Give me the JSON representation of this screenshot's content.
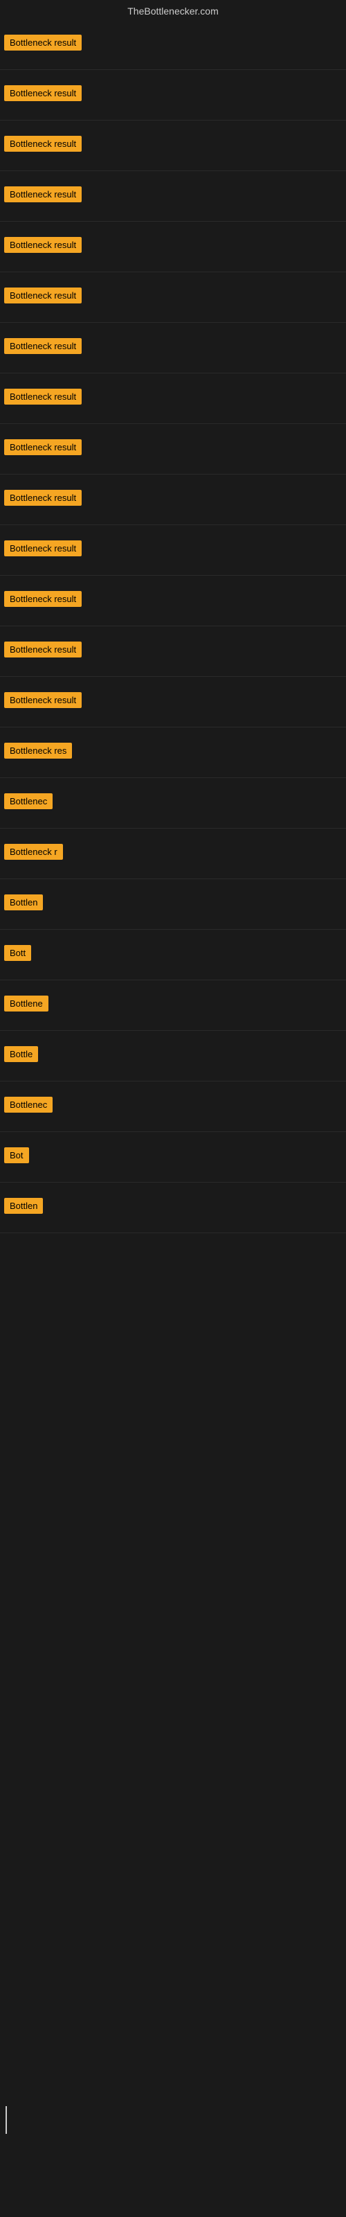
{
  "header": {
    "title": "TheBottlenecker.com"
  },
  "rows": [
    {
      "label": "Bottleneck result",
      "width": "full"
    },
    {
      "label": "Bottleneck result",
      "width": "full"
    },
    {
      "label": "Bottleneck result",
      "width": "full"
    },
    {
      "label": "Bottleneck result",
      "width": "full"
    },
    {
      "label": "Bottleneck result",
      "width": "full"
    },
    {
      "label": "Bottleneck result",
      "width": "full"
    },
    {
      "label": "Bottleneck result",
      "width": "full"
    },
    {
      "label": "Bottleneck result",
      "width": "full"
    },
    {
      "label": "Bottleneck result",
      "width": "full"
    },
    {
      "label": "Bottleneck result",
      "width": "full"
    },
    {
      "label": "Bottleneck result",
      "width": "full"
    },
    {
      "label": "Bottleneck result",
      "width": "full"
    },
    {
      "label": "Bottleneck result",
      "width": "full"
    },
    {
      "label": "Bottleneck result",
      "width": "full"
    },
    {
      "label": "Bottleneck res",
      "width": "partial1"
    },
    {
      "label": "Bottlenec",
      "width": "partial2"
    },
    {
      "label": "Bottleneck r",
      "width": "partial3"
    },
    {
      "label": "Bottlen",
      "width": "partial4"
    },
    {
      "label": "Bott",
      "width": "partial5"
    },
    {
      "label": "Bottlene",
      "width": "partial6"
    },
    {
      "label": "Bottle",
      "width": "partial7"
    },
    {
      "label": "Bottlenec",
      "width": "partial8"
    },
    {
      "label": "Bot",
      "width": "partial9"
    },
    {
      "label": "Bottlen",
      "width": "partial10"
    }
  ]
}
